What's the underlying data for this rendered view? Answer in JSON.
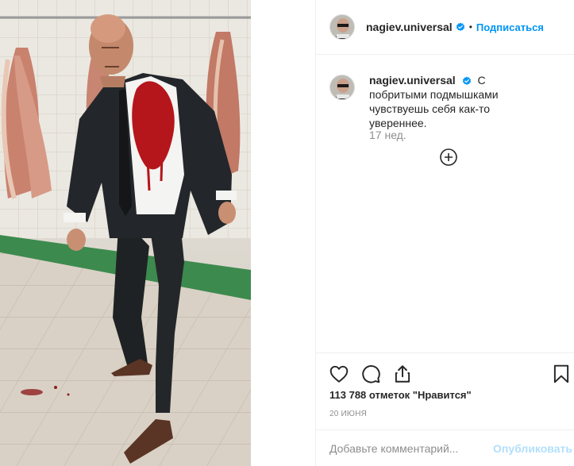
{
  "post": {
    "username": "nagiev.universal",
    "follow_label": "Подписаться",
    "separator": "•",
    "caption": "С побритыми подмышками чувствуешь себя как-то увереннее.",
    "time_ago": "17 нед.",
    "likes_text": "113 788 отметок \"Нравится\"",
    "date_text": "20 ИЮНЯ",
    "comment_placeholder": "Добавьте комментарий...",
    "publish_label": "Опубликовать"
  },
  "colors": {
    "accent": "#0095f6",
    "publish_disabled": "#b2dffc",
    "muted": "#8e8e8e",
    "text": "#262626"
  },
  "icons": {
    "verified": "verified-badge-icon",
    "more": "plus-circle-icon",
    "like": "heart-icon",
    "comment": "speech-bubble-icon",
    "share": "share-icon",
    "save": "bookmark-icon"
  }
}
